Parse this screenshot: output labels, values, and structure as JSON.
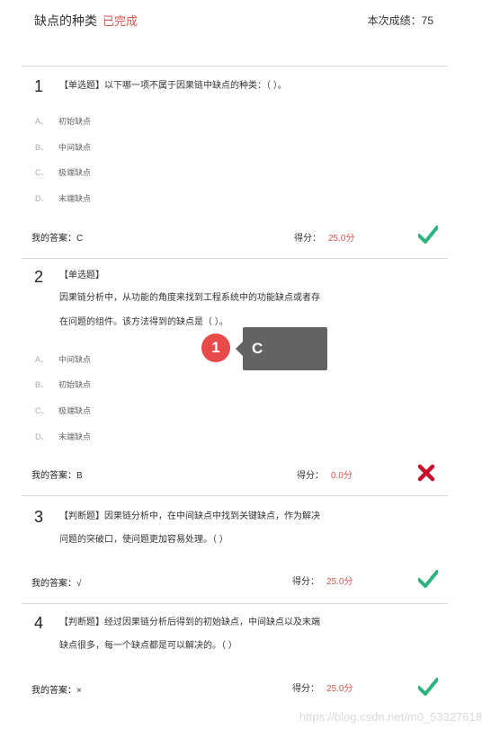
{
  "header": {
    "title": "缺点的种类",
    "status": "已完成",
    "score_label": "本次成绩：75"
  },
  "questions": [
    {
      "number": "1",
      "text_lines": [
        "【单选题】以下哪一项不属于因果链中缺点的种类：（ ）。"
      ],
      "options": [
        {
          "letter": "A、",
          "text": "初始缺点"
        },
        {
          "letter": "B、",
          "text": "中间缺点"
        },
        {
          "letter": "C、",
          "text": "极端缺点"
        },
        {
          "letter": "D、",
          "text": "末端缺点"
        }
      ],
      "answer_label": "我的答案：",
      "answer_value": "C",
      "score_label": "得分：",
      "score_value": "25.0分",
      "result": "correct"
    },
    {
      "number": "2",
      "text_lines": [
        "【单选题】",
        "因果链分析中，从功能的角度来找到工程系统中的功能缺点或者存",
        "在问题的组件。该方法得到的缺点是（ ）。"
      ],
      "options": [
        {
          "letter": "A、",
          "text": "中间缺点"
        },
        {
          "letter": "B、",
          "text": "初始缺点"
        },
        {
          "letter": "C、",
          "text": "极端缺点"
        },
        {
          "letter": "D、",
          "text": "末端缺点"
        }
      ],
      "answer_label": "我的答案：",
      "answer_value": "B",
      "score_label": "得分：",
      "score_value": "0.0分",
      "result": "wrong"
    },
    {
      "number": "3",
      "text_lines": [
        "【判断题】因果链分析中，在中间缺点中找到关键缺点，作为解决",
        "问题的突破口，使问题更加容易处理。（ ）"
      ],
      "answer_label": "我的答案：",
      "answer_value": "√",
      "score_label": "得分：",
      "score_value": "25.0分",
      "result": "correct"
    },
    {
      "number": "4",
      "text_lines": [
        "【判断题】经过因果链分析后得到的初始缺点，中间缺点以及末端",
        "缺点很多，每一个缺点都是可以解决的。（ ）"
      ],
      "answer_label": "我的答案：",
      "answer_value": "×",
      "score_label": "得分：",
      "score_value": "25.0分",
      "result": "correct"
    }
  ],
  "annotation": {
    "badge": "1",
    "text": "C"
  },
  "watermark": "https://blog.csdn.net/m0_53327618",
  "colors": {
    "correct": "#2fb380",
    "wrong": "#c8102e",
    "score": "#d9534f"
  }
}
